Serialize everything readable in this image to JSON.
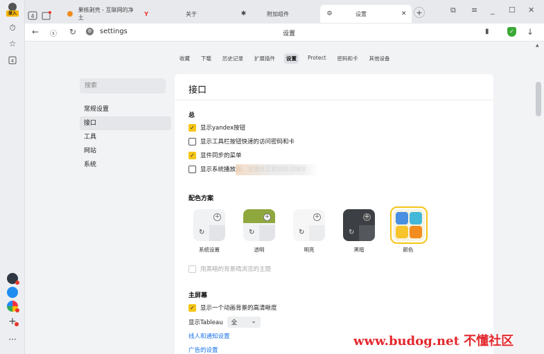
{
  "tabs": [
    {
      "label": "果核剥壳 - 互联网的净土",
      "icon": "nut-icon"
    },
    {
      "label": "关于",
      "icon": "yandex-y-icon"
    },
    {
      "label": "附加组件",
      "icon": "puzzle-icon"
    },
    {
      "label": "设置",
      "icon": "gear-icon"
    }
  ],
  "address": {
    "url": "settings",
    "title": "设置"
  },
  "login_badge": "录入",
  "topnav": [
    "收藏",
    "下载",
    "历史记录",
    "扩展插件",
    "设置",
    "Protect",
    "密码和卡",
    "其他设备"
  ],
  "topnav_selected": 4,
  "search": {
    "placeholder": "搜索"
  },
  "side_menu": [
    "常规设置",
    "接口",
    "工具",
    "网站",
    "系统"
  ],
  "side_selected": 1,
  "panel": {
    "title": "接口",
    "general_title": "总",
    "general_options": [
      {
        "label": "显示yandex按钮",
        "checked": true
      },
      {
        "label": "显示工具栏按钮快速的访问密码和卡",
        "checked": false
      },
      {
        "label": "显件同步的菜单",
        "checked": true
      },
      {
        "label": "显示系统播放器，当播放互联网络流媒体",
        "checked": false
      }
    ],
    "theme_title": "配色方案",
    "themes": [
      {
        "label": "系统设置"
      },
      {
        "label": "透明"
      },
      {
        "label": "明亮"
      },
      {
        "label": "黑暗"
      },
      {
        "label": "颜色",
        "selected": true
      }
    ],
    "dark_bg_option": "用黑暗的背景晴浏览的主题",
    "home_title": "主屏幕",
    "home_option": "显示一个动画背景的高清晰度",
    "tableau_label": "显示Tableau",
    "tableau_value": "全",
    "link1": "线人和通知设置",
    "link2": "广告的设置"
  },
  "watermark": "www.budog.net 不懂社区",
  "colors": {
    "accent": "#f5c518",
    "link": "#1a73e8",
    "shield": "#3ba935",
    "watermark": "#e3282d"
  }
}
